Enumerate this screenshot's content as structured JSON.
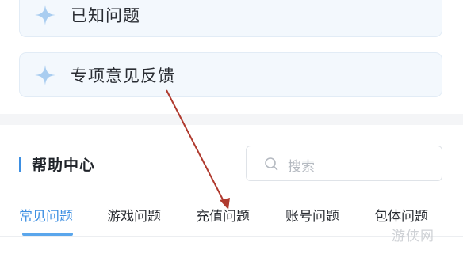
{
  "cards": [
    {
      "label": "已知问题",
      "icon": "sparkle-icon"
    },
    {
      "label": "专项意见反馈",
      "icon": "sparkle-icon"
    }
  ],
  "help_center": {
    "title": "帮助中心",
    "search_placeholder": "搜索"
  },
  "tabs": [
    {
      "label": "常见问题",
      "active": true
    },
    {
      "label": "游戏问题",
      "active": false
    },
    {
      "label": "充值问题",
      "active": false
    },
    {
      "label": "账号问题",
      "active": false
    },
    {
      "label": "包体问题",
      "active": false
    }
  ],
  "annotation": {
    "arrow_color": "#b03a2e"
  },
  "watermark": "游侠网",
  "colors": {
    "accent": "#3d8fe2",
    "card_bg": "#f3f8fd",
    "sparkle": "#a9cdf0"
  }
}
